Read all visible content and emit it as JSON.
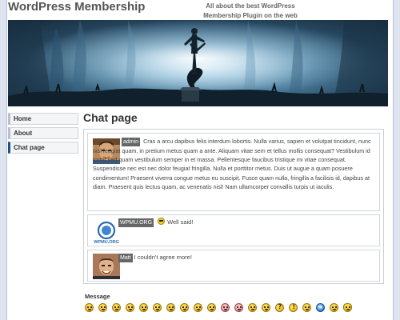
{
  "site": {
    "title": "WordPress Membership",
    "tagline": "All about the best WordPress Membership Plugin on the web"
  },
  "nav": [
    {
      "label": "Home",
      "active": false
    },
    {
      "label": "About",
      "active": false
    },
    {
      "label": "Chat page",
      "active": true
    }
  ],
  "page": {
    "title": "Chat page"
  },
  "chat": {
    "messages": [
      {
        "author": "admin",
        "avatar": "admin-photo-avatar",
        "text": "Cras a arcu dapibus felis interdum lobortis. Nulla varius, sapien et volutpat tincidunt, nunc nisl feugiat quam, in pretium metus quam a ante. Aliquam vitae sem et tellus mollis consequat? Vestibulum id tortor sed quam vestibulum semper in et massa. Pellentesque faucibus tristique mi vitae consequat. Suspendisse nec est nec dolor feugiat fringilla. Nulla et porttitor metus. Duis ut augue a quam posuere condimentum! Praesent viverra congue metus eu suscipit. Fusce quam nulla, fringilla a facilisis id, dapibus at diam. Praesent quis lectus quam, ac venenatis nisl! Nam ullamcorper convallis turpis ut iaculis."
      },
      {
        "author": "WPMU.ORG",
        "avatar": "wpmu-logo-avatar",
        "avatar_text": "WPMU.ORG",
        "emoticon": "cool-sunglasses-smiley-icon",
        "text": "Well said!"
      },
      {
        "author": "Matt",
        "avatar": "matt-photo-avatar",
        "text": "I couldn't agree more!"
      }
    ]
  },
  "composer": {
    "label": "Message",
    "smileys": [
      "smile",
      "grin",
      "wink",
      "sad",
      "surprised",
      "cool",
      "tongue",
      "laugh",
      "confused",
      "neutral",
      "angry",
      "blush",
      "evil",
      "eek",
      "question",
      "exclamation",
      "idea",
      "arrow",
      "mad",
      "cat"
    ]
  },
  "colors": {
    "nav_active_accent": "#1d4f8c",
    "name_tag_bg": "#666666"
  }
}
